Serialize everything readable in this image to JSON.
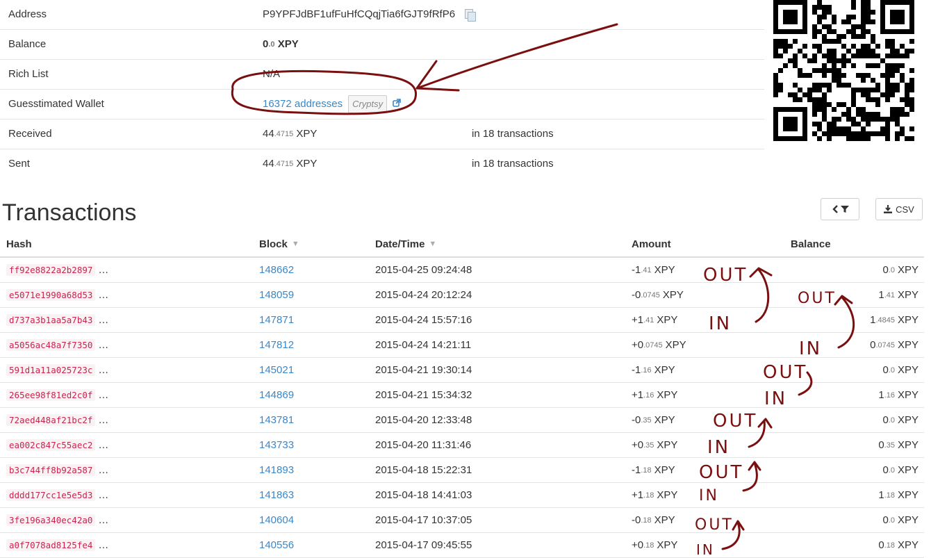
{
  "address": {
    "rows": [
      {
        "label": "Address",
        "value": "P9YPFJdBF1ufFuHfCQqjTia6fGJT9fRfP6"
      },
      {
        "label": "Balance",
        "int": "0",
        "dec": ".0",
        "unit": "XPY"
      },
      {
        "label": "Rich List",
        "value": "N/A"
      },
      {
        "label": "Guesstimated Wallet",
        "link": "16372 addresses",
        "tag": "Cryptsy"
      },
      {
        "label": "Received",
        "int": "44",
        "dec": ".4715",
        "unit": "XPY",
        "extra": "in 18 transactions"
      },
      {
        "label": "Sent",
        "int": "44",
        "dec": ".4715",
        "unit": "XPY",
        "extra": "in 18 transactions"
      }
    ]
  },
  "transactions": {
    "title": "Transactions",
    "csv_label": "CSV",
    "headers": {
      "hash": "Hash",
      "block": "Block",
      "datetime": "Date/Time",
      "amount": "Amount",
      "balance": "Balance"
    },
    "rows": [
      {
        "hash": "ff92e8822a2b2897",
        "block": "148662",
        "date": "2015-04-25 09:24:48",
        "amt_sign": "- ",
        "amt_int": "1",
        "amt_dec": ".41",
        "bal_int": "0",
        "bal_dec": ".0"
      },
      {
        "hash": "e5071e1990a68d53",
        "block": "148059",
        "date": "2015-04-24 20:12:24",
        "amt_sign": "- ",
        "amt_int": "0",
        "amt_dec": ".0745",
        "bal_int": "1",
        "bal_dec": ".41"
      },
      {
        "hash": "d737a3b1aa5a7b43",
        "block": "147871",
        "date": "2015-04-24 15:57:16",
        "amt_sign": "+ ",
        "amt_int": "1",
        "amt_dec": ".41",
        "bal_int": "1",
        "bal_dec": ".4845"
      },
      {
        "hash": "a5056ac48a7f7350",
        "block": "147812",
        "date": "2015-04-24 14:21:11",
        "amt_sign": "+ ",
        "amt_int": "0",
        "amt_dec": ".0745",
        "bal_int": "0",
        "bal_dec": ".0745"
      },
      {
        "hash": "591d1a11a025723c",
        "block": "145021",
        "date": "2015-04-21 19:30:14",
        "amt_sign": "- ",
        "amt_int": "1",
        "amt_dec": ".16",
        "bal_int": "0",
        "bal_dec": ".0"
      },
      {
        "hash": "265ee98f81ed2c0f",
        "block": "144869",
        "date": "2015-04-21 15:34:32",
        "amt_sign": "+ ",
        "amt_int": "1",
        "amt_dec": ".16",
        "bal_int": "1",
        "bal_dec": ".16"
      },
      {
        "hash": "72aed448af21bc2f",
        "block": "143781",
        "date": "2015-04-20 12:33:48",
        "amt_sign": "- ",
        "amt_int": "0",
        "amt_dec": ".35",
        "bal_int": "0",
        "bal_dec": ".0"
      },
      {
        "hash": "ea002c847c55aec2",
        "block": "143733",
        "date": "2015-04-20 11:31:46",
        "amt_sign": "+ ",
        "amt_int": "0",
        "amt_dec": ".35",
        "bal_int": "0",
        "bal_dec": ".35"
      },
      {
        "hash": "b3c744ff8b92a587",
        "block": "141893",
        "date": "2015-04-18 15:22:31",
        "amt_sign": "- ",
        "amt_int": "1",
        "amt_dec": ".18",
        "bal_int": "0",
        "bal_dec": ".0"
      },
      {
        "hash": "dddd177cc1e5e5d3",
        "block": "141863",
        "date": "2015-04-18 14:41:03",
        "amt_sign": "+ ",
        "amt_int": "1",
        "amt_dec": ".18",
        "bal_int": "1",
        "bal_dec": ".18"
      },
      {
        "hash": "3fe196a340ec42a0",
        "block": "140604",
        "date": "2015-04-17 10:37:05",
        "amt_sign": "- ",
        "amt_int": "0",
        "amt_dec": ".18",
        "bal_int": "0",
        "bal_dec": ".0"
      },
      {
        "hash": "a0f7078ad8125fe4",
        "block": "140556",
        "date": "2015-04-17 09:45:55",
        "amt_sign": "+ ",
        "amt_int": "0",
        "amt_dec": ".18",
        "bal_int": "0",
        "bal_dec": ".18"
      }
    ],
    "unit": "XPY",
    "ellipsis": "…"
  },
  "annotations": {
    "out_label": "OUT",
    "in_label": "IN",
    "ink_color": "#7a0f0f"
  },
  "icons": {
    "copy": "copy-icon",
    "external": "external-link-icon",
    "sort": "sort-icon",
    "filter": "filter-icon",
    "download": "download-icon",
    "qr": "qr-code"
  }
}
